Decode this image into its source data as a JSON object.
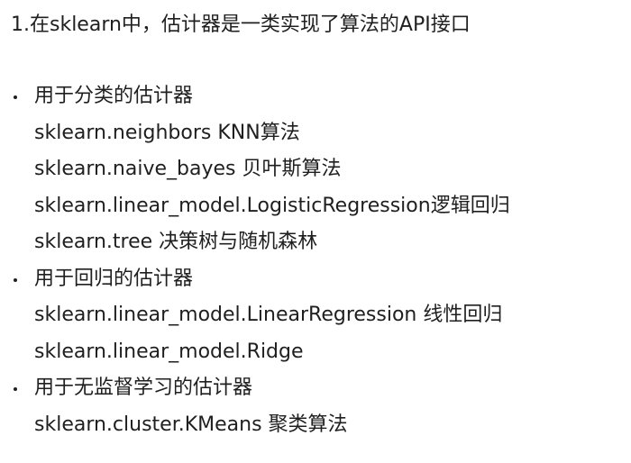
{
  "heading": "1.在sklearn中，估计器是一类实现了算法的API接口",
  "groups": [
    {
      "title": "用于分类的估计器",
      "items": [
        "sklearn.neighbors KNN算法",
        "sklearn.naive_bayes 贝叶斯算法",
        "sklearn.linear_model.LogisticRegression逻辑回归",
        "sklearn.tree 决策树与随机森林"
      ]
    },
    {
      "title": "用于回归的估计器",
      "items": [
        "sklearn.linear_model.LinearRegression 线性回归",
        "sklearn.linear_model.Ridge"
      ]
    },
    {
      "title": "用于无监督学习的估计器",
      "items": [
        "sklearn.cluster.KMeans 聚类算法"
      ]
    }
  ]
}
